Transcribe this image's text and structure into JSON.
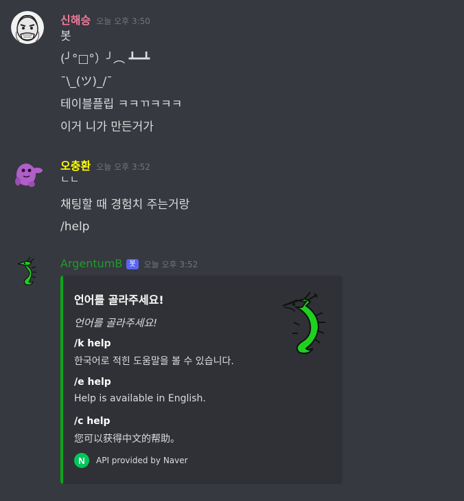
{
  "messages": [
    {
      "username": "신해승",
      "username_color": "#f47b9e",
      "timestamp": "오늘 오후 3:50",
      "lines": [
        "봇",
        "(╯°□°）╯︵ ┻━┻",
        "¯\\_(ツ)_/¯",
        "테이블플립 ㅋㅋㄲㅋㅋㅋ",
        "이거 니가 만든거가"
      ]
    },
    {
      "username": "오충환",
      "username_color": "#ffff00",
      "timestamp": "오늘 오후 3:52",
      "lines": [
        "ㄴㄴ",
        "채팅할 때 경험치 주는거랑",
        "/help"
      ]
    },
    {
      "username": "ArgentumB",
      "username_color": "#1f9d2a",
      "bot_tag": "봇",
      "timestamp": "오늘 오후 3:52"
    }
  ],
  "embed": {
    "accent_color": "#0ba61b",
    "title": "언어를 골라주세요!",
    "description": "언어를 골라주세요!",
    "fields": [
      {
        "name": "/k help",
        "value": "한국어로 적힌 도움말을 볼 수 있습니다."
      },
      {
        "name": "/e help",
        "value": "Help is available in English."
      },
      {
        "name": "/c help",
        "value": "您可以获得中文的帮助。"
      }
    ],
    "footer_icon_letter": "N",
    "footer_text": "API provided by Naver"
  }
}
